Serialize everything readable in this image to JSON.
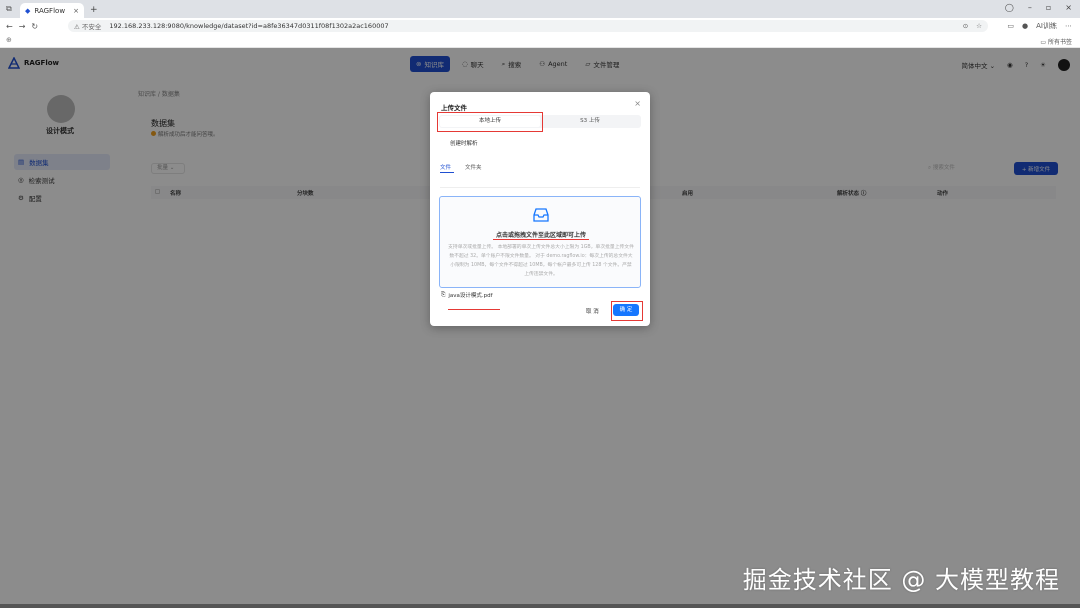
{
  "browser": {
    "tab_title": "RAGFlow",
    "new_tab": "+",
    "insecure_label": "不安全",
    "url": "192.168.233.128:9080/knowledge/dataset?id=a8fe36347d0311f08f1302a2ac160007",
    "profile_label": "AI训练",
    "bookmark_right": "所有书签"
  },
  "app": {
    "logo_text": "RAGFlow",
    "nav": [
      {
        "label": "知识库"
      },
      {
        "label": "聊天"
      },
      {
        "label": "搜索"
      },
      {
        "label": "Agent"
      },
      {
        "label": "文件管理"
      }
    ],
    "language": "简体中文",
    "language_caret": "⌄"
  },
  "sidebar": {
    "kb_name": "设计模式",
    "items": [
      {
        "label": "数据集"
      },
      {
        "label": "检索测试"
      },
      {
        "label": "配置"
      }
    ]
  },
  "content": {
    "breadcrumb": "知识库 / 数据集",
    "title": "数据集",
    "subtitle": "解析成功后才能问答哦。",
    "batch_label": "批量",
    "batch_caret": "⌄",
    "search_placeholder": "搜索文件",
    "new_file_label": "+ 新增文件",
    "columns": [
      {
        "label": "名称"
      },
      {
        "label": "分块数"
      },
      {
        "label": "启用"
      },
      {
        "label": "解析状态 ⓘ"
      },
      {
        "label": "动作"
      }
    ]
  },
  "modal": {
    "title": "上传文件",
    "close": "×",
    "tab_local": "本地上传",
    "tab_s3": "S3 上传",
    "create_parse": "创建时解析",
    "subtab_file": "文件",
    "subtab_folder": "文件夹",
    "dropzone_main": "点击或拖拽文件至此区域即可上传",
    "dropzone_desc": "支持单次或批量上传。 本地部署的单次上传文件总大小上限为 1GB，单次批量上传文件数不超过 32。单个账户不限文件数量。 对于 demo.ragflow.io：每次上传的总文件大小限制为 10MB，每个文件不得超过 10MB，每个帐户最多可上传 128 个文件。严禁上传违禁文件。",
    "file_name": "java设计模式.pdf",
    "cancel_label": "取 消",
    "ok_label": "确 定"
  },
  "watermark": "掘金技术社区 @ 大模型教程",
  "colors": {
    "accent": "#1f4fd1",
    "highlight": "#e53935",
    "primary_button": "#1677ff"
  }
}
